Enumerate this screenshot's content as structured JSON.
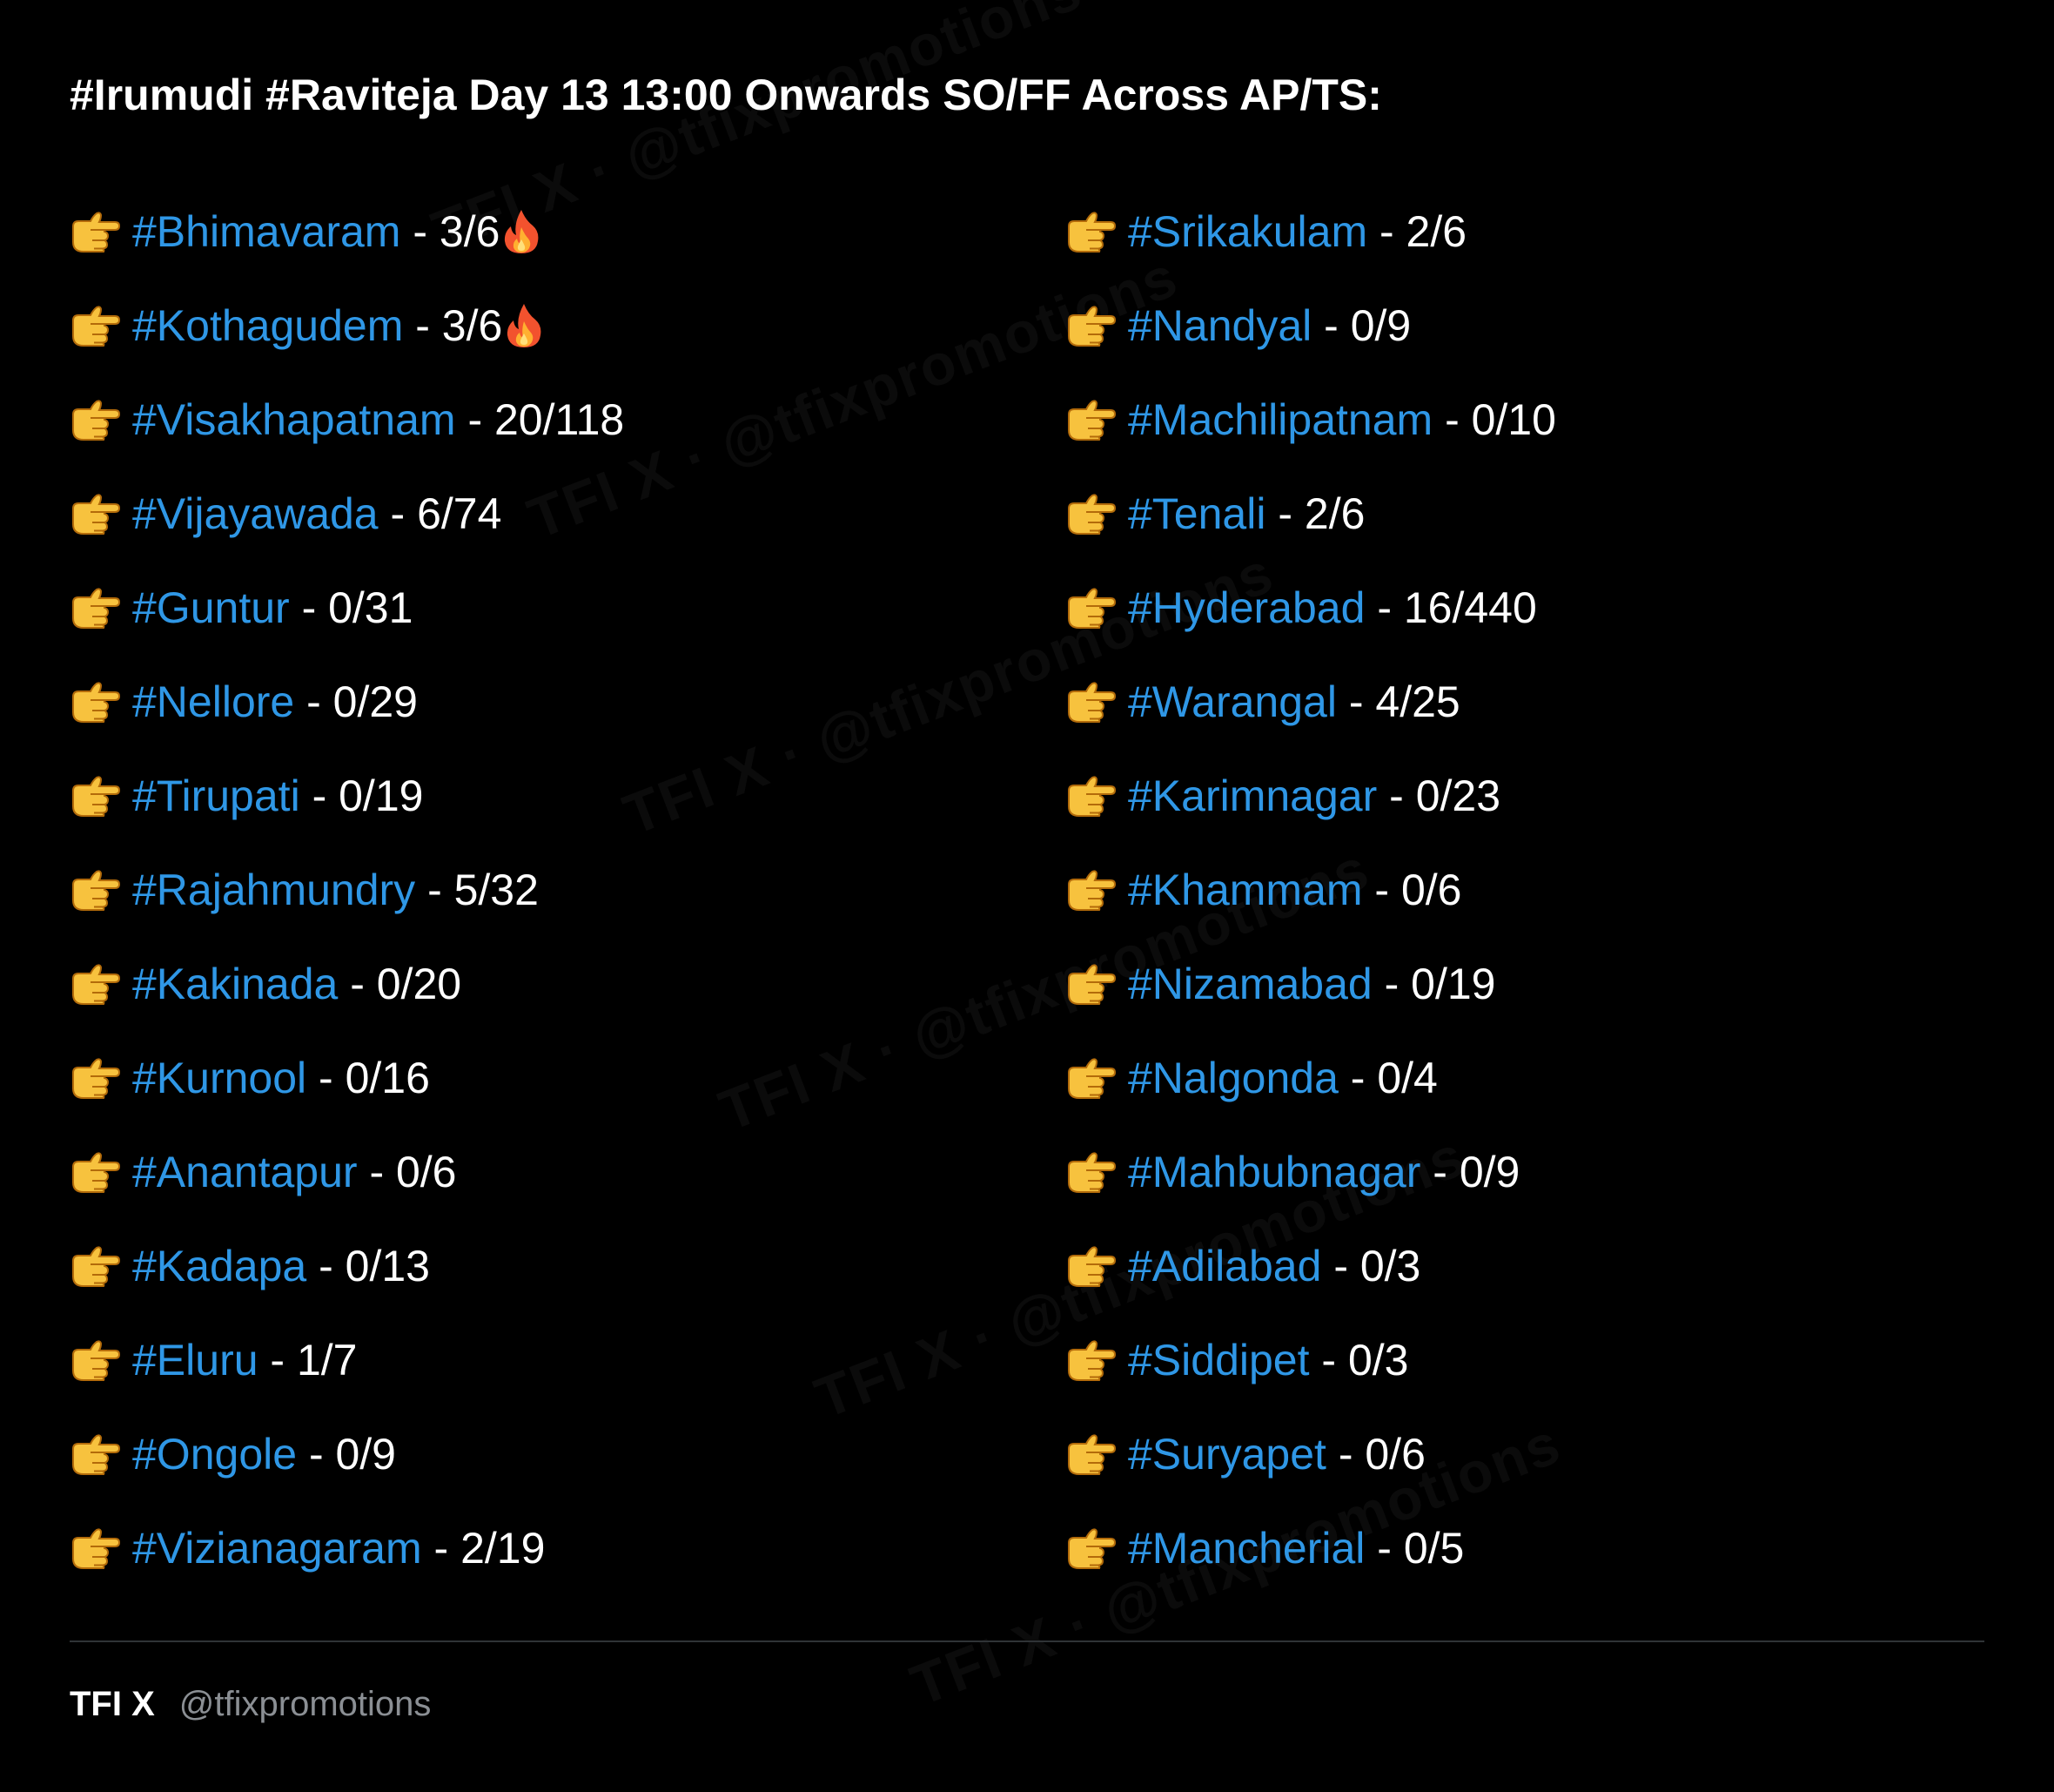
{
  "title": "#Irumudi #Raviteja Day 13 13:00 Onwards SO/FF Across AP/TS:",
  "left_column": [
    {
      "city": "#Bhimavaram",
      "value": "3/6",
      "fire": true
    },
    {
      "city": "#Kothagudem",
      "value": "3/6",
      "fire": true
    },
    {
      "city": "#Visakhapatnam",
      "value": "20/118",
      "fire": false
    },
    {
      "city": "#Vijayawada",
      "value": "6/74",
      "fire": false
    },
    {
      "city": "#Guntur",
      "value": "0/31",
      "fire": false
    },
    {
      "city": "#Nellore",
      "value": "0/29",
      "fire": false
    },
    {
      "city": "#Tirupati",
      "value": "0/19",
      "fire": false
    },
    {
      "city": "#Rajahmundry",
      "value": "5/32",
      "fire": false
    },
    {
      "city": "#Kakinada",
      "value": "0/20",
      "fire": false
    },
    {
      "city": "#Kurnool",
      "value": "0/16",
      "fire": false
    },
    {
      "city": "#Anantapur",
      "value": "0/6",
      "fire": false
    },
    {
      "city": "#Kadapa",
      "value": "0/13",
      "fire": false
    },
    {
      "city": "#Eluru",
      "value": "1/7",
      "fire": false
    },
    {
      "city": "#Ongole",
      "value": "0/9",
      "fire": false
    },
    {
      "city": "#Vizianagaram",
      "value": "2/19",
      "fire": false
    }
  ],
  "right_column": [
    {
      "city": "#Srikakulam",
      "value": "2/6",
      "fire": false
    },
    {
      "city": "#Nandyal",
      "value": "0/9",
      "fire": false
    },
    {
      "city": "#Machilipatnam",
      "value": "0/10",
      "fire": false
    },
    {
      "city": "#Tenali",
      "value": "2/6",
      "fire": false
    },
    {
      "city": "#Hyderabad",
      "value": "16/440",
      "fire": false
    },
    {
      "city": "#Warangal",
      "value": "4/25",
      "fire": false
    },
    {
      "city": "#Karimnagar",
      "value": "0/23",
      "fire": false
    },
    {
      "city": "#Khammam",
      "value": "0/6",
      "fire": false
    },
    {
      "city": "#Nizamabad",
      "value": "0/19",
      "fire": false
    },
    {
      "city": "#Nalgonda",
      "value": "0/4",
      "fire": false
    },
    {
      "city": "#Mahbubnagar",
      "value": "0/9",
      "fire": false
    },
    {
      "city": "#Adilabad",
      "value": "0/3",
      "fire": false
    },
    {
      "city": "#Siddipet",
      "value": "0/3",
      "fire": false
    },
    {
      "city": "#Suryapet",
      "value": "0/6",
      "fire": false
    },
    {
      "city": "#Mancherial",
      "value": "0/5",
      "fire": false
    }
  ],
  "separator": " - ",
  "bullet_icon": "backhand-index-pointing-right-icon",
  "fire_icon": "fire-icon",
  "footer": {
    "brand": "TFI X",
    "handle": "@tfixpromotions"
  },
  "watermark_text": "TFI X · @tfixpromotions",
  "colors": {
    "background": "#000000",
    "hashtag": "#2f97e6",
    "text": "#ffffff",
    "handle": "#8b8f94",
    "divider": "#2f3336"
  }
}
